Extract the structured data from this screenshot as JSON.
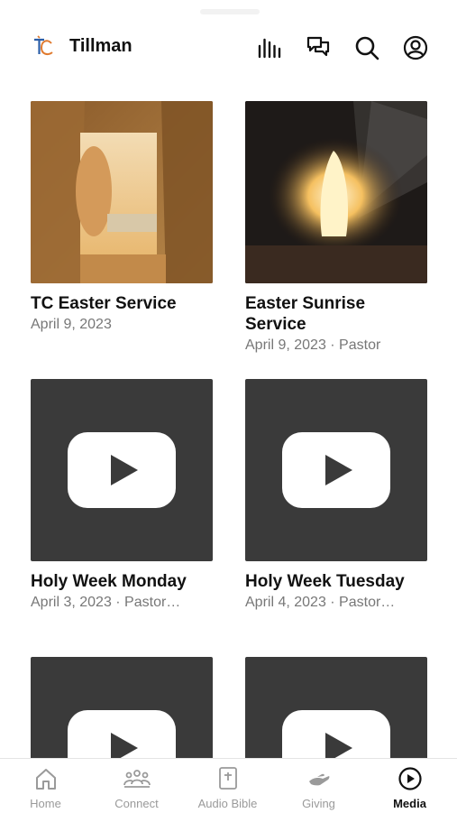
{
  "header": {
    "title": "Tillman",
    "logo_text": "TC",
    "icons": [
      "equalizer-icon",
      "chat-icon",
      "search-icon",
      "profile-icon"
    ]
  },
  "media": [
    {
      "title": "TC Easter Service",
      "meta": "April 9, 2023",
      "thumb": "open-tomb-photo"
    },
    {
      "title": "Easter Sunrise Service",
      "meta": "April 9, 2023 · Pastor",
      "thumb": "tomb-light-photo"
    },
    {
      "title": "Holy Week Monday",
      "meta": "April 3, 2023 · Pastor…",
      "thumb": "video-play-placeholder"
    },
    {
      "title": "Holy Week Tuesday",
      "meta": "April 4, 2023 · Pastor…",
      "thumb": "video-play-placeholder"
    },
    {
      "title": "",
      "meta": "",
      "thumb": "video-play-placeholder"
    },
    {
      "title": "",
      "meta": "",
      "thumb": "video-play-placeholder"
    }
  ],
  "tabbar": {
    "items": [
      {
        "label": "Home",
        "icon": "home-icon"
      },
      {
        "label": "Connect",
        "icon": "group-icon"
      },
      {
        "label": "Audio Bible",
        "icon": "bible-icon"
      },
      {
        "label": "Giving",
        "icon": "giving-hand-icon"
      },
      {
        "label": "Media",
        "icon": "play-circle-icon"
      }
    ],
    "active": "Media"
  },
  "colors": {
    "placeholder_bg": "#3a3a3a",
    "inactive_tab": "#9a9a9a",
    "logo_blue": "#2b5ea8",
    "logo_orange": "#e07a2e"
  }
}
